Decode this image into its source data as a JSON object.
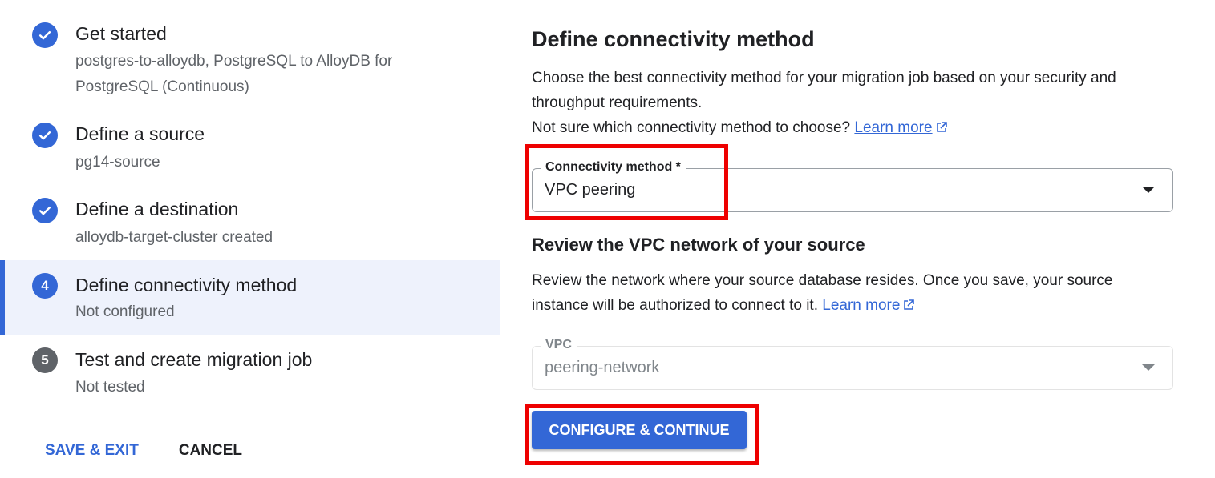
{
  "steps": [
    {
      "number": "",
      "status": "complete",
      "title": "Get started",
      "subtitle": [
        "postgres-to-alloydb, PostgreSQL to AlloyDB for",
        "PostgreSQL (Continuous)"
      ]
    },
    {
      "number": "",
      "status": "complete",
      "title": "Define a source",
      "subtitle": [
        "pg14-source"
      ]
    },
    {
      "number": "",
      "status": "complete",
      "title": "Define a destination",
      "subtitle": [
        "alloydb-target-cluster created"
      ]
    },
    {
      "number": "4",
      "status": "active",
      "title": "Define connectivity method",
      "subtitle": [
        "Not configured"
      ]
    },
    {
      "number": "5",
      "status": "pending",
      "title": "Test and create migration job",
      "subtitle": [
        "Not tested"
      ]
    }
  ],
  "actions": {
    "save_exit": "SAVE & EXIT",
    "cancel": "CANCEL"
  },
  "form": {
    "title": "Define connectivity method",
    "desc_line1": "Choose the best connectivity method for your migration job based on your security and",
    "desc_line2": "throughput requirements.",
    "desc_line3": "Not sure which connectivity method to choose?",
    "learn_more": "Learn more",
    "connectivity_label": "Connectivity method *",
    "connectivity_value": "VPC peering",
    "section_title": "Review the VPC network of your source",
    "section_desc1": "Review the network where your source database resides. Once you save, your source",
    "section_desc2": "instance will be authorized to connect to it.",
    "section_learn_more": "Learn more",
    "vpc_label": "VPC",
    "vpc_value": "peering-network",
    "submit": "CONFIGURE & CONTINUE"
  },
  "colors": {
    "accent": "#3367d6",
    "highlight": "#ee0000",
    "active_bg": "#eef2fc"
  }
}
